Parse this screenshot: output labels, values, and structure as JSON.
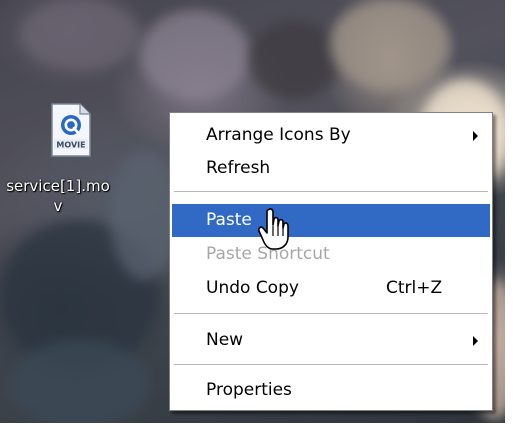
{
  "desktop": {
    "icon": {
      "name": "movie-file-icon",
      "badge_text": "MOVIE",
      "filename": "service[1].mov"
    }
  },
  "context_menu": {
    "items": [
      {
        "label": "Arrange Icons By",
        "shortcut": "",
        "submenu": true,
        "state": "normal"
      },
      {
        "label": "Refresh",
        "shortcut": "",
        "submenu": false,
        "state": "normal"
      },
      {
        "label": "Paste",
        "shortcut": "",
        "submenu": false,
        "state": "highlighted"
      },
      {
        "label": "Paste Shortcut",
        "shortcut": "",
        "submenu": false,
        "state": "disabled"
      },
      {
        "label": "Undo Copy",
        "shortcut": "Ctrl+Z",
        "submenu": false,
        "state": "normal"
      },
      {
        "label": "New",
        "shortcut": "",
        "submenu": true,
        "state": "normal"
      },
      {
        "label": "Properties",
        "shortcut": "",
        "submenu": false,
        "state": "normal"
      }
    ]
  },
  "colors": {
    "highlight": "#316ac5",
    "disabled_text": "#a7a7a7",
    "menu_background": "#ffffff"
  }
}
